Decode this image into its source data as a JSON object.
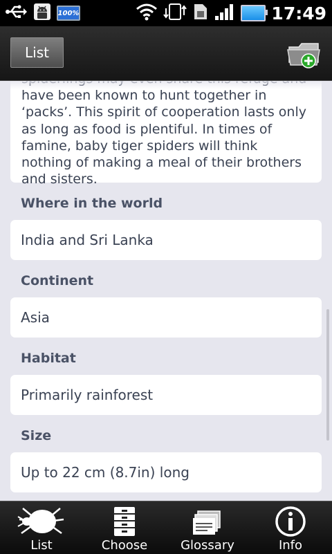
{
  "status_bar": {
    "battery_small_label": "100%",
    "time": "17:49"
  },
  "action_bar": {
    "list_button": "List",
    "add_folder_icon": "folder-add-icon"
  },
  "description": {
    "text": "spiderlings may even share this refuge and have been known to hunt together in ‘packs’. This spirit of cooperation lasts only as long as food is plentiful. In times of famine, baby tiger spiders will think nothing of making a meal of their brothers and sisters."
  },
  "details": [
    {
      "label": "Where in the world",
      "value": "India and Sri Lanka"
    },
    {
      "label": "Continent",
      "value": "Asia"
    },
    {
      "label": "Habitat",
      "value": "Primarily rainforest"
    },
    {
      "label": "Size",
      "value": "Up to 22 cm (8.7in) long"
    }
  ],
  "tabs": [
    {
      "label": "List",
      "icon": "bug-icon"
    },
    {
      "label": "Choose",
      "icon": "cabinet-icon"
    },
    {
      "label": "Glossary",
      "icon": "glossary-icon"
    },
    {
      "label": "Info",
      "icon": "info-icon"
    }
  ]
}
